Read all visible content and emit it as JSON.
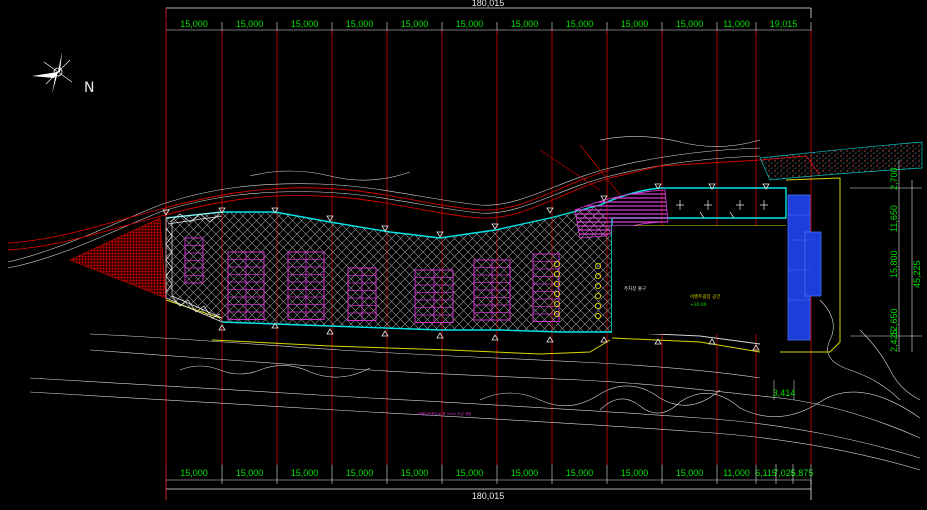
{
  "drawing": {
    "overall_width_label": "180,015",
    "top_bay_labels": [
      "15,000",
      "15,000",
      "15,000",
      "15,000",
      "15,000",
      "15,000",
      "15,000",
      "15,000",
      "15,000",
      "15,000",
      "11,000",
      "19,015"
    ],
    "bottom_bay_labels": [
      "15,000",
      "15,000",
      "15,000",
      "15,000",
      "15,000",
      "15,000",
      "15,000",
      "15,000",
      "15,000",
      "15,000",
      "11,000",
      "6,115",
      "7,025",
      "5,875"
    ],
    "right_dims": [
      "11,650",
      "2,700",
      "15,800",
      "45,225",
      "12,650",
      "2,425"
    ],
    "small_dim_label": "3,414",
    "north_label": "N",
    "annotations": {
      "plaza_label": "이벤트광장 공간",
      "plaza_sub": "+30.00",
      "parking_label": "주차장 출구",
      "bottom_note": "보행자전용도로 폭 3.0m 조성 예정"
    }
  },
  "colors": {
    "grid": "#d00000",
    "dimension_text": "#00e000",
    "boundary": "#00e5e5",
    "parking": "#cc33cc",
    "hatch": "#bfbfbf",
    "terrain": "#ffffff",
    "blue_block": "#1d3ed8",
    "edge": "#d8d800",
    "accent_yellow": "#e8e000"
  }
}
